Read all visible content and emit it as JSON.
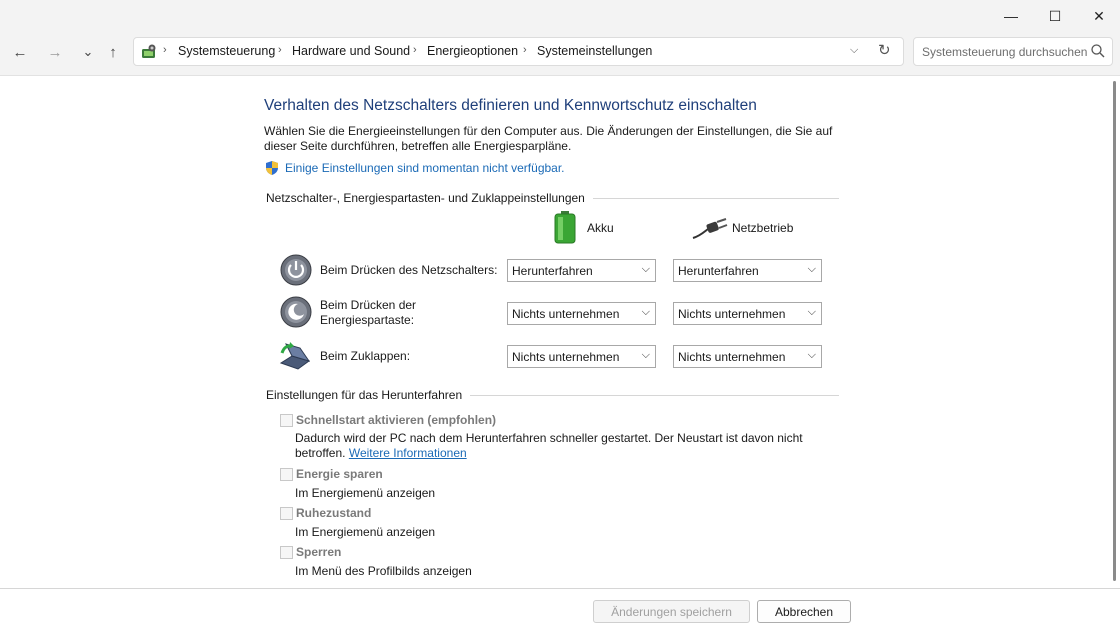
{
  "window": {
    "minimize_glyph": "—",
    "maximize_glyph": "☐",
    "close_glyph": "✕"
  },
  "nav": {
    "back_glyph": "←",
    "forward_glyph": "→",
    "recent_glyph": "⌄",
    "up_glyph": "↑",
    "breadcrumbs": [
      "Systemsteuerung",
      "Hardware und Sound",
      "Energieoptionen",
      "Systemeinstellungen"
    ],
    "crumb_sep": "›",
    "search_placeholder": "Systemsteuerung durchsuchen"
  },
  "page": {
    "title": "Verhalten des Netzschalters definieren und Kennwortschutz einschalten",
    "description": "Wählen Sie die Energieeinstellungen für den Computer aus. Die Änderungen der Einstellungen, die Sie auf dieser Seite durchführen, betreffen alle Energiesparpläne.",
    "unavailable_link": "Einige Einstellungen sind momentan nicht verfügbar."
  },
  "buttons_section": {
    "heading": "Netzschalter-, Energiespartasten- und Zuklappeinstellungen",
    "col_battery": "Akku",
    "col_ac": "Netzbetrieb",
    "rows": [
      {
        "label": "Beim Drücken des Netzschalters:",
        "battery": "Herunterfahren",
        "ac": "Herunterfahren"
      },
      {
        "label_line1": "Beim Drücken der",
        "label_line2": "Energiespartaste:",
        "battery": "Nichts unternehmen",
        "ac": "Nichts unternehmen"
      },
      {
        "label": "Beim Zuklappen:",
        "battery": "Nichts unternehmen",
        "ac": "Nichts unternehmen"
      }
    ]
  },
  "shutdown_section": {
    "heading": "Einstellungen für das Herunterfahren",
    "options": [
      {
        "label": "Schnellstart aktivieren (empfohlen)",
        "desc_line1": "Dadurch wird der PC nach dem Herunterfahren schneller gestartet. Der Neustart ist davon nicht",
        "desc_line2": "betroffen.",
        "more_link": "Weitere Informationen",
        "checked": false
      },
      {
        "label": "Energie sparen",
        "desc": "Im Energiemenü anzeigen",
        "checked": false
      },
      {
        "label": "Ruhezustand",
        "desc": "Im Energiemenü anzeigen",
        "checked": false
      },
      {
        "label": "Sperren",
        "desc": "Im Menü des Profilbilds anzeigen",
        "checked": false
      }
    ]
  },
  "footer": {
    "save": "Änderungen speichern",
    "cancel": "Abbrechen"
  },
  "colors": {
    "title": "#1f3f7a",
    "link": "#1b6ab6",
    "battery_green": "#3aa534"
  }
}
